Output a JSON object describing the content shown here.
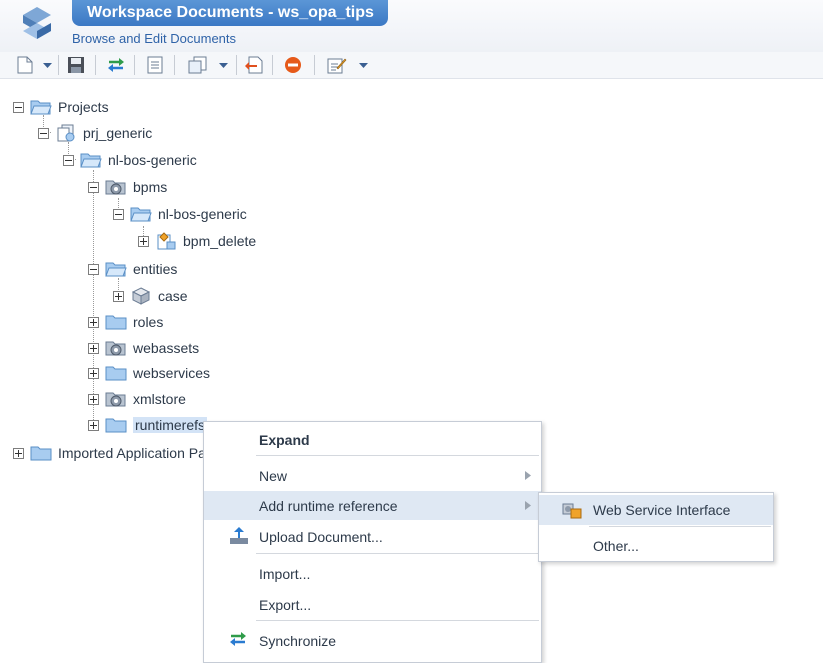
{
  "header": {
    "title": "Workspace Documents - ws_opa_tips",
    "subtitle": "Browse and Edit Documents"
  },
  "toolbar": {
    "icons": [
      "new-document-icon",
      "dropdown-arrow-icon",
      "save-icon",
      "synchronize-icon",
      "properties-icon",
      "copy-icon",
      "dropdown-arrow-icon",
      "export-icon",
      "stop-icon",
      "edit-icon",
      "dropdown-arrow-icon"
    ]
  },
  "tree": {
    "projects": "Projects",
    "prj_generic": "prj_generic",
    "nl_bos_generic": "nl-bos-generic",
    "bpms": "bpms",
    "bpms_nl_bos_generic": "nl-bos-generic",
    "bpm_delete": "bpm_delete",
    "entities": "entities",
    "case": "case",
    "roles": "roles",
    "webassets": "webassets",
    "webservices": "webservices",
    "xmlstore": "xmlstore",
    "runtimerefs": "runtimerefs",
    "imported": "Imported Application Pa"
  },
  "context_menu": {
    "expand": "Expand",
    "new": "New",
    "add_runtime_reference": "Add runtime reference",
    "upload_document": "Upload Document...",
    "import": "Import...",
    "export": "Export...",
    "synchronize": "Synchronize"
  },
  "submenu": {
    "web_service_interface": "Web Service Interface",
    "other": "Other..."
  },
  "colors": {
    "accent": "#3b78c4",
    "highlight": "#dfe8f3",
    "folder": "#7fb3e6"
  }
}
